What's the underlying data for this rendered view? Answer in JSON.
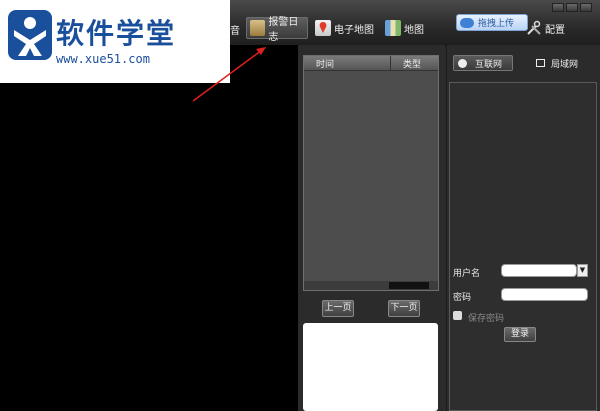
{
  "logo": {
    "title": "软件学堂",
    "url": "www.xue51.com"
  },
  "toolbar": {
    "partial_label": "音",
    "alarm_log_label": "报警日志",
    "emap_label": "电子地图",
    "map_label": "地图",
    "upload_label": "拖拽上传",
    "config_label": "配置"
  },
  "log_table": {
    "columns": [
      "时间",
      "类型"
    ],
    "prev_label": "上一页",
    "next_label": "下一页"
  },
  "login": {
    "tabs": [
      "互联网",
      "局域网"
    ],
    "username_label": "用户名",
    "password_label": "密码",
    "username_value": "",
    "password_value": "",
    "remember_label": "保存密码",
    "login_button": "登录"
  },
  "colors": {
    "brand": "#1a4f9c",
    "arrow": "#e02020",
    "panel": "#2b2b2b"
  }
}
